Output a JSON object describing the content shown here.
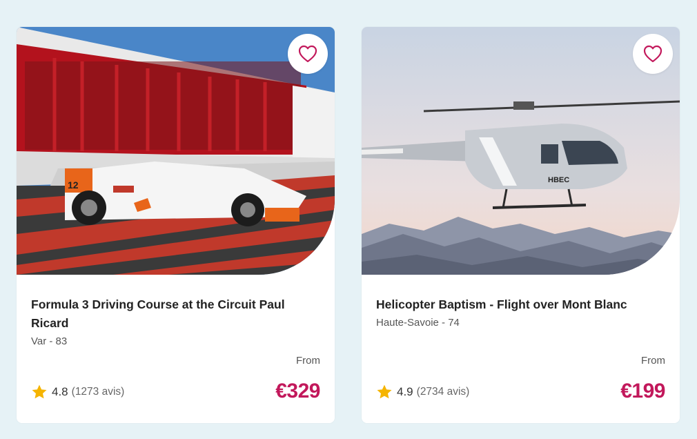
{
  "accent_color": "#c2185b",
  "star_color": "#f5b400",
  "cards": [
    {
      "image_alt": "White Formula 3 race car in front of circuit building",
      "favorite_icon": "heart-outline-icon",
      "title": "Formula 3 Driving Course at the Circuit Paul Ricard",
      "location": "Var - 83",
      "from_label": "From",
      "price": "€329",
      "rating": "4.8",
      "reviews": "1273 avis"
    },
    {
      "image_alt": "Helicopter flying above mountain range",
      "favorite_icon": "heart-outline-icon",
      "title": "Helicopter Baptism - Flight over Mont Blanc",
      "location": "Haute-Savoie - 74",
      "from_label": "From",
      "price": "€199",
      "rating": "4.9",
      "reviews": "2734 avis"
    }
  ]
}
